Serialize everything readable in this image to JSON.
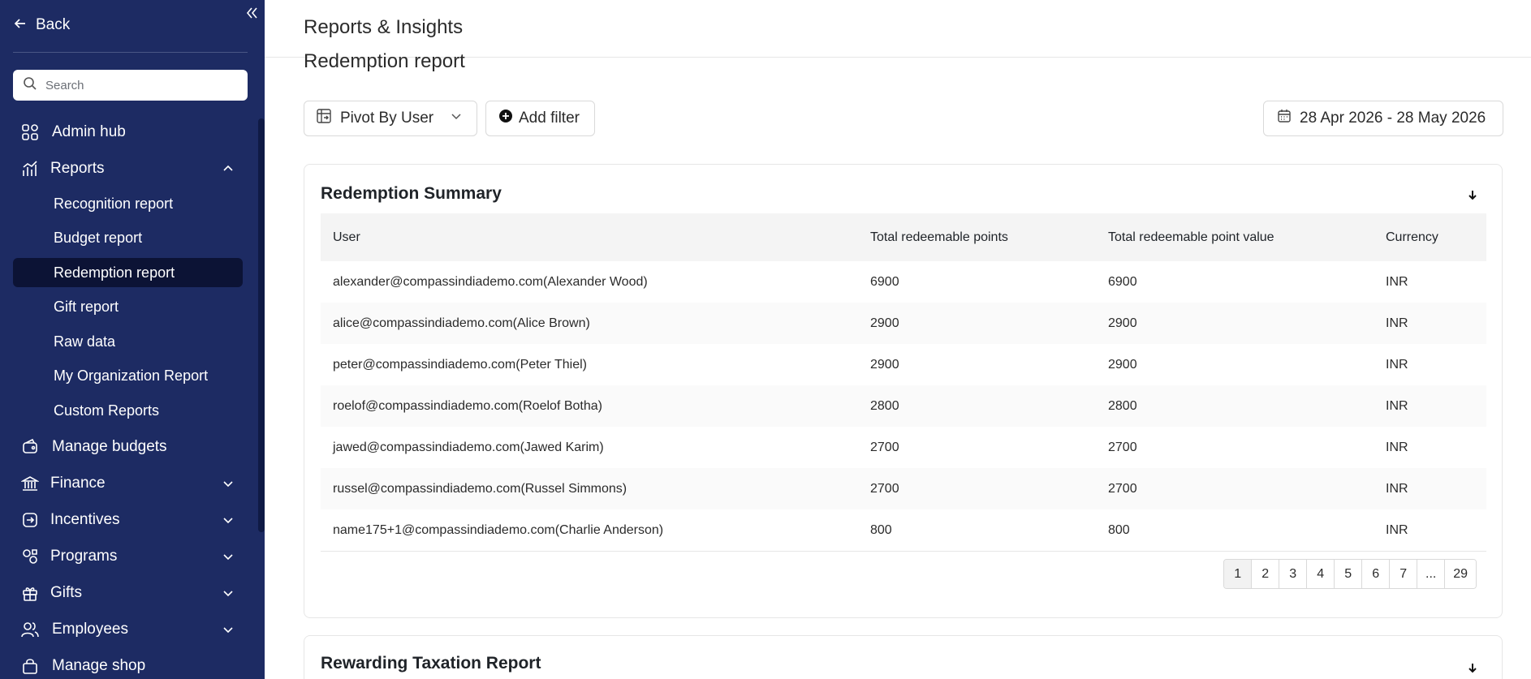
{
  "sidebar": {
    "back_label": "Back",
    "search_placeholder": "Search",
    "items": [
      {
        "label": "Admin hub",
        "icon": "grid-icon"
      },
      {
        "label": "Reports",
        "icon": "chart-icon",
        "expanded": true,
        "children": [
          {
            "label": "Recognition report"
          },
          {
            "label": "Budget report"
          },
          {
            "label": "Redemption report",
            "active": true
          },
          {
            "label": "Gift report"
          },
          {
            "label": "Raw data"
          },
          {
            "label": "My Organization Report"
          },
          {
            "label": "Custom Reports"
          }
        ]
      },
      {
        "label": "Manage budgets",
        "icon": "wallet-icon"
      },
      {
        "label": "Finance",
        "icon": "bank-icon"
      },
      {
        "label": "Incentives",
        "icon": "incentive-icon"
      },
      {
        "label": "Programs",
        "icon": "programs-icon"
      },
      {
        "label": "Gifts",
        "icon": "gift-icon"
      },
      {
        "label": "Employees",
        "icon": "users-icon"
      },
      {
        "label": "Manage shop",
        "icon": "shop-icon"
      }
    ]
  },
  "header": {
    "title": "Reports & Insights",
    "section": "Redemption report"
  },
  "toolbar": {
    "pivot_label": "Pivot By User",
    "filter_label": "Add filter",
    "date_range": "28 Apr 2026 - 28 May 2026"
  },
  "summary": {
    "title": "Redemption Summary",
    "columns": [
      "User",
      "Total redeemable points",
      "Total redeemable point value",
      "Currency"
    ],
    "rows": [
      [
        "alexander@compassindiademo.com(Alexander Wood)",
        "6900",
        "6900",
        "INR"
      ],
      [
        "alice@compassindiademo.com(Alice Brown)",
        "2900",
        "2900",
        "INR"
      ],
      [
        "peter@compassindiademo.com(Peter Thiel)",
        "2900",
        "2900",
        "INR"
      ],
      [
        "roelof@compassindiademo.com(Roelof Botha)",
        "2800",
        "2800",
        "INR"
      ],
      [
        "jawed@compassindiademo.com(Jawed Karim)",
        "2700",
        "2700",
        "INR"
      ],
      [
        "russel@compassindiademo.com(Russel Simmons)",
        "2700",
        "2700",
        "INR"
      ],
      [
        "name175+1@compassindiademo.com(Charlie Anderson)",
        "800",
        "800",
        "INR"
      ]
    ],
    "pagination": [
      "1",
      "2",
      "3",
      "4",
      "5",
      "6",
      "7",
      "...",
      "29"
    ],
    "current_page": "1"
  },
  "taxation": {
    "title": "Rewarding Taxation Report"
  },
  "colors": {
    "sidebar_bg": "#1d2b63",
    "sidebar_active_bg": "#0c1335",
    "header_bg": "#f4f4f4"
  }
}
